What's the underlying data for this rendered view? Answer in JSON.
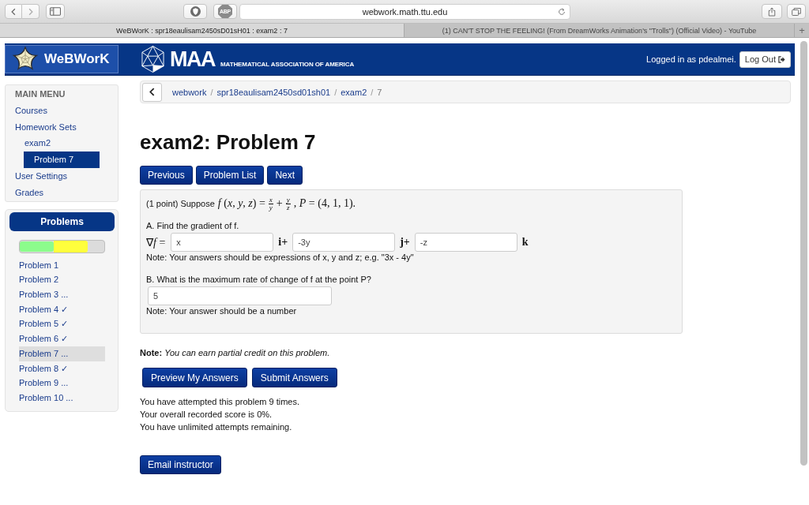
{
  "browser": {
    "url": "webwork.math.ttu.edu",
    "extension_label": "ABP",
    "tabs": [
      {
        "title": "WeBWorK : spr18eaulisam2450sD01sH01 : exam2 : 7",
        "selected": true
      },
      {
        "title": "(1) CAN'T STOP THE FEELING! (From DreamWorks Animation's \"Trolls\") (Official Video) - YouTube",
        "selected": false
      }
    ],
    "new_tab": "+"
  },
  "header": {
    "logo": "WeBWorK",
    "maa_abbreviation": "MAA",
    "maa_name": "MATHEMATICAL ASSOCIATION OF AMERICA",
    "login_status": "Logged in as pdealmei.",
    "logout_button": "Log Out"
  },
  "main_menu": {
    "title": "MAIN MENU",
    "items": [
      {
        "label": "Courses",
        "selected": false
      },
      {
        "label": "Homework Sets",
        "selected": false,
        "children": [
          {
            "label": "exam2",
            "selected": false,
            "children": [
              {
                "label": "Problem 7",
                "selected": true
              }
            ]
          }
        ]
      },
      {
        "label": "User Settings",
        "selected": false
      },
      {
        "label": "Grades",
        "selected": false
      }
    ]
  },
  "problems_panel": {
    "title": "Problems",
    "progress": [
      {
        "level": 0.4,
        "color": "#8cfc8c"
      },
      {
        "level": 0.8,
        "color": "#ffff3c"
      }
    ],
    "items": [
      {
        "label": "Problem 1",
        "selected": false
      },
      {
        "label": "Problem 2",
        "selected": false
      },
      {
        "label": "Problem 3 ...",
        "selected": false
      },
      {
        "label": "Problem 4 ✓",
        "selected": false
      },
      {
        "label": "Problem 5 ✓",
        "selected": false
      },
      {
        "label": "Problem 6 ✓",
        "selected": false
      },
      {
        "label": "Problem 7 ...",
        "selected": true
      },
      {
        "label": "Problem 8 ✓",
        "selected": false
      },
      {
        "label": "Problem 9 ...",
        "selected": false
      },
      {
        "label": "Problem 10 ...",
        "selected": false
      }
    ]
  },
  "breadcrumb": {
    "separator": "/",
    "items": [
      {
        "label": "webwork",
        "link": true
      },
      {
        "label": "spr18eaulisam2450sd01sh01",
        "link": true
      },
      {
        "label": "exam2",
        "link": true
      },
      {
        "label": "7",
        "link": false
      }
    ]
  },
  "page_title": "exam2: Problem 7",
  "nav_buttons": [
    "Previous",
    "Problem List",
    "Next"
  ],
  "problem": {
    "statement": [
      {
        "kind": "text",
        "text": "(1 point) Suppose"
      },
      {
        "kind": "math",
        "text": "*f* (*x*, *y*, *z*) ="
      },
      {
        "kind": "frac",
        "num": "*x*",
        "den": "*y*"
      },
      {
        "kind": "math",
        "text": "+"
      },
      {
        "kind": "frac",
        "num": "*y*",
        "den": "*z*"
      },
      {
        "kind": "math",
        "text": ", *P* = (4, 1, 1)."
      }
    ],
    "parts": [
      {
        "prompt": "A. Find the gradient of f.",
        "answer_row": [
          {
            "kind": "math",
            "text": "∇*f* ="
          },
          {
            "kind": "input",
            "value": "x"
          },
          {
            "kind": "unit",
            "text": "i+"
          },
          {
            "kind": "input",
            "value": "-3y"
          },
          {
            "kind": "unit",
            "text": "j+"
          },
          {
            "kind": "input",
            "value": "-z"
          },
          {
            "kind": "unit",
            "text": "k"
          }
        ],
        "note": "Note: Your answers should be expressions of x, y and z; e.g. \"3x - 4y\""
      },
      {
        "prompt": "B. What is the maximum rate of change of f at the point P?",
        "answer_row": [
          {
            "kind": "input",
            "value": "5"
          }
        ],
        "note": "Note: Your answer should be a number"
      }
    ]
  },
  "credit_note": "**Note:** *You can earn partial credit on this problem.*",
  "submit_buttons": [
    "Preview My Answers",
    "Submit Answers"
  ],
  "attempt_info": [
    "You have attempted this problem 9 times.",
    "Your overall recorded score is 0%.",
    "You have unlimited attempts remaining."
  ],
  "email_button": "Email instructor"
}
